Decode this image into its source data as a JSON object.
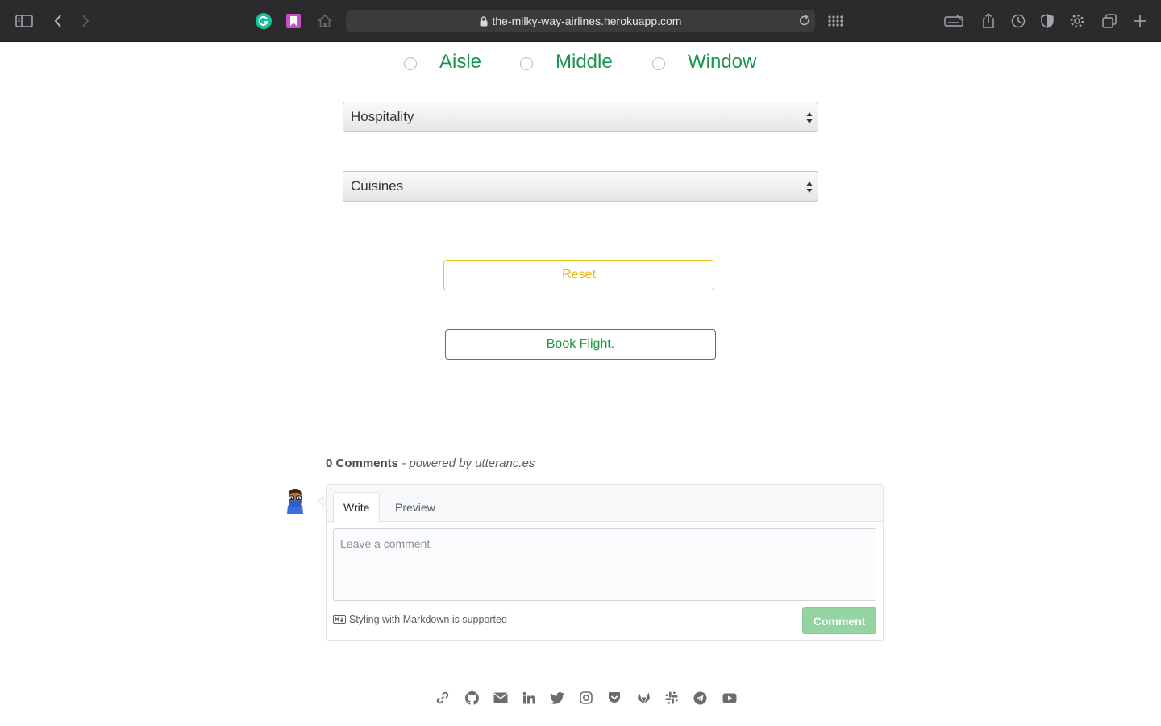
{
  "browser": {
    "url": "the-milky-way-airlines.herokuapp.com",
    "left_icons": [
      "sidebar-icon",
      "back-icon",
      "forward-icon"
    ],
    "extension_icons": [
      "grammarly-icon",
      "bookmark-extension-icon",
      "home-icon"
    ],
    "right_icons": [
      "keyboard-icon",
      "share-icon",
      "history-icon",
      "privacy-icon",
      "settings-icon",
      "tabs-icon",
      "new-tab-icon"
    ]
  },
  "seat": {
    "options": [
      {
        "label": "Aisle",
        "checked": false
      },
      {
        "label": "Middle",
        "checked": false
      },
      {
        "label": "Window",
        "checked": false
      }
    ]
  },
  "selects": {
    "hospitality": "Hospitality",
    "cuisines": "Cuisines"
  },
  "buttons": {
    "reset": "Reset",
    "book": "Book Flight."
  },
  "comments": {
    "count_label": "0 Comments",
    "powered_sep": " - ",
    "powered_label": "powered by utteranc.es",
    "tab_write": "Write",
    "tab_preview": "Preview",
    "placeholder": "Leave a comment",
    "markdown_note": "Styling with Markdown is supported",
    "submit": "Comment"
  },
  "footer": {
    "social_icons": [
      "link-icon",
      "github-icon",
      "email-icon",
      "linkedin-icon",
      "twitter-icon",
      "instagram-icon",
      "pocket-icon",
      "gitlab-icon",
      "slack-icon",
      "telegram-icon",
      "youtube-icon"
    ]
  },
  "colors": {
    "seat_green": "#1b944f",
    "reset_yellow": "#f0b400",
    "book_green": "#1b9a3f",
    "comment_btn": "#94d3a2"
  }
}
